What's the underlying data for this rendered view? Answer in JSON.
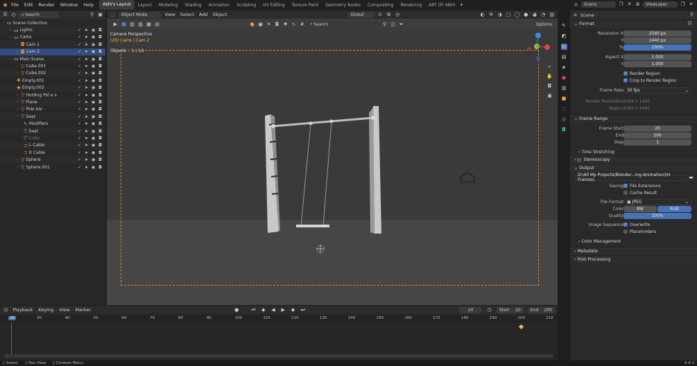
{
  "top_menu": [
    "File",
    "Edit",
    "Render",
    "Window",
    "Help"
  ],
  "workspaces": [
    "Abhi's Layout",
    "Layout",
    "Modeling",
    "Shading",
    "Animation",
    "Sculpting",
    "UV Editing",
    "Texture Paint",
    "Geometry Nodes",
    "Compositing",
    "Rendering",
    "ART OF ABHI"
  ],
  "scene_name": "Scene",
  "view_layer": "ViewLayer",
  "outliner": {
    "search_placeholder": "Search",
    "rows": [
      {
        "label": "Scene Collection",
        "indent": 0,
        "icon": "coll"
      },
      {
        "label": "Lights",
        "indent": 1,
        "icon": "coll"
      },
      {
        "label": "Cams",
        "indent": 1,
        "icon": "coll"
      },
      {
        "label": "Cam 1",
        "indent": 2,
        "icon": "cam"
      },
      {
        "label": "Cam 2",
        "indent": 2,
        "icon": "cam",
        "selected": true
      },
      {
        "label": "Main Scene",
        "indent": 1,
        "icon": "coll"
      },
      {
        "label": "Cube.001",
        "indent": 2,
        "icon": "mesh"
      },
      {
        "label": "Cube.002",
        "indent": 2,
        "icon": "mesh"
      },
      {
        "label": "Empty.001",
        "indent": 2,
        "icon": "empty"
      },
      {
        "label": "Empty.003",
        "indent": 2,
        "icon": "empty"
      },
      {
        "label": "Holding Pol e s",
        "indent": 2,
        "icon": "mesh"
      },
      {
        "label": "Plane",
        "indent": 2,
        "icon": "mesh"
      },
      {
        "label": "Pole bar",
        "indent": 2,
        "icon": "mesh"
      },
      {
        "label": "Seat",
        "indent": 2,
        "icon": "mesh"
      },
      {
        "label": "Modifiers",
        "indent": 3,
        "icon": "mod"
      },
      {
        "label": "Seat",
        "indent": 3,
        "icon": "data"
      },
      {
        "label": "Cube",
        "indent": 3,
        "icon": "mesh",
        "dim": true
      },
      {
        "label": "L Cable",
        "indent": 3,
        "icon": "curve"
      },
      {
        "label": "R Cable",
        "indent": 3,
        "icon": "curve"
      },
      {
        "label": "Sphere",
        "indent": 2,
        "icon": "mesh"
      },
      {
        "label": "Sphere.001",
        "indent": 2,
        "icon": "mesh"
      }
    ]
  },
  "viewport": {
    "mode": "Object Mode",
    "menus": [
      "View",
      "Select",
      "Add",
      "Object"
    ],
    "transform": "Global",
    "search_placeholder": "Search",
    "options": "Options",
    "overlay_title": "Camera Perspective",
    "overlay_sub": "(20) Cams | Cam 2",
    "overlay_obj": "Objects",
    "overlay_count": "1 / 18"
  },
  "properties": {
    "context": "Scene",
    "format_title": "Format",
    "resolution_x_label": "Resolution X",
    "resolution_x": "2560 px",
    "y_label": "Y",
    "resolution_y": "1440 px",
    "pct_label": "%",
    "resolution_pct": "100%",
    "aspect_x_label": "Aspect X",
    "aspect_x": "1.000",
    "aspect_y": "1.000",
    "render_region": "Render Region",
    "crop_region": "Crop to Render Region",
    "frame_rate_label": "Frame Rate",
    "frame_rate": "30 fps",
    "render_res_label": "Render Resolution",
    "render_res": "2560 x 1440",
    "region_label": "Region",
    "region": "2560 x 1440",
    "frame_range_title": "Frame Range",
    "frame_start_label": "Frame Start",
    "frame_start": "20",
    "end_label": "End",
    "frame_end": "200",
    "step_label": "Step",
    "frame_step": "1",
    "time_stretching": "Time Stretching",
    "stereoscopy": "Stereoscopy",
    "output_title": "Output",
    "output_path": "D:\\All My Projects\\Blender...ing Animation)\\H Frames\\",
    "saving_label": "Saving",
    "file_extensions": "File Extensions",
    "cache_result": "Cache Result",
    "file_format_label": "File Format",
    "file_format": "JPEG",
    "color_label": "Color",
    "color_bw": "BW",
    "color_rgb": "RGB",
    "quality_label": "Quality",
    "quality": "100%",
    "image_sequence_label": "Image Sequence",
    "overwrite": "Overwrite",
    "placeholders": "Placeholders",
    "color_management": "Color Management",
    "metadata": "Metadata",
    "post_processing": "Post Processing"
  },
  "timeline": {
    "menus": [
      "Playback",
      "Keying",
      "View",
      "Marker"
    ],
    "current_frame": "20",
    "start_label": "Start",
    "start": "20",
    "end_label": "End",
    "end": "200",
    "ticks": [
      "20",
      "30",
      "40",
      "50",
      "60",
      "70",
      "80",
      "90",
      "100",
      "110",
      "120",
      "130",
      "140",
      "150",
      "160",
      "170",
      "180",
      "190",
      "200",
      "210"
    ]
  },
  "status": {
    "select": "Select",
    "pan": "Pan View",
    "context": "Context Menu",
    "version": "4.4.1"
  },
  "colors": {
    "accent_blue": "#4772b3",
    "selection": "#334d80",
    "camera_frame": "#d9823b",
    "object_orange": "#f39b3b"
  }
}
